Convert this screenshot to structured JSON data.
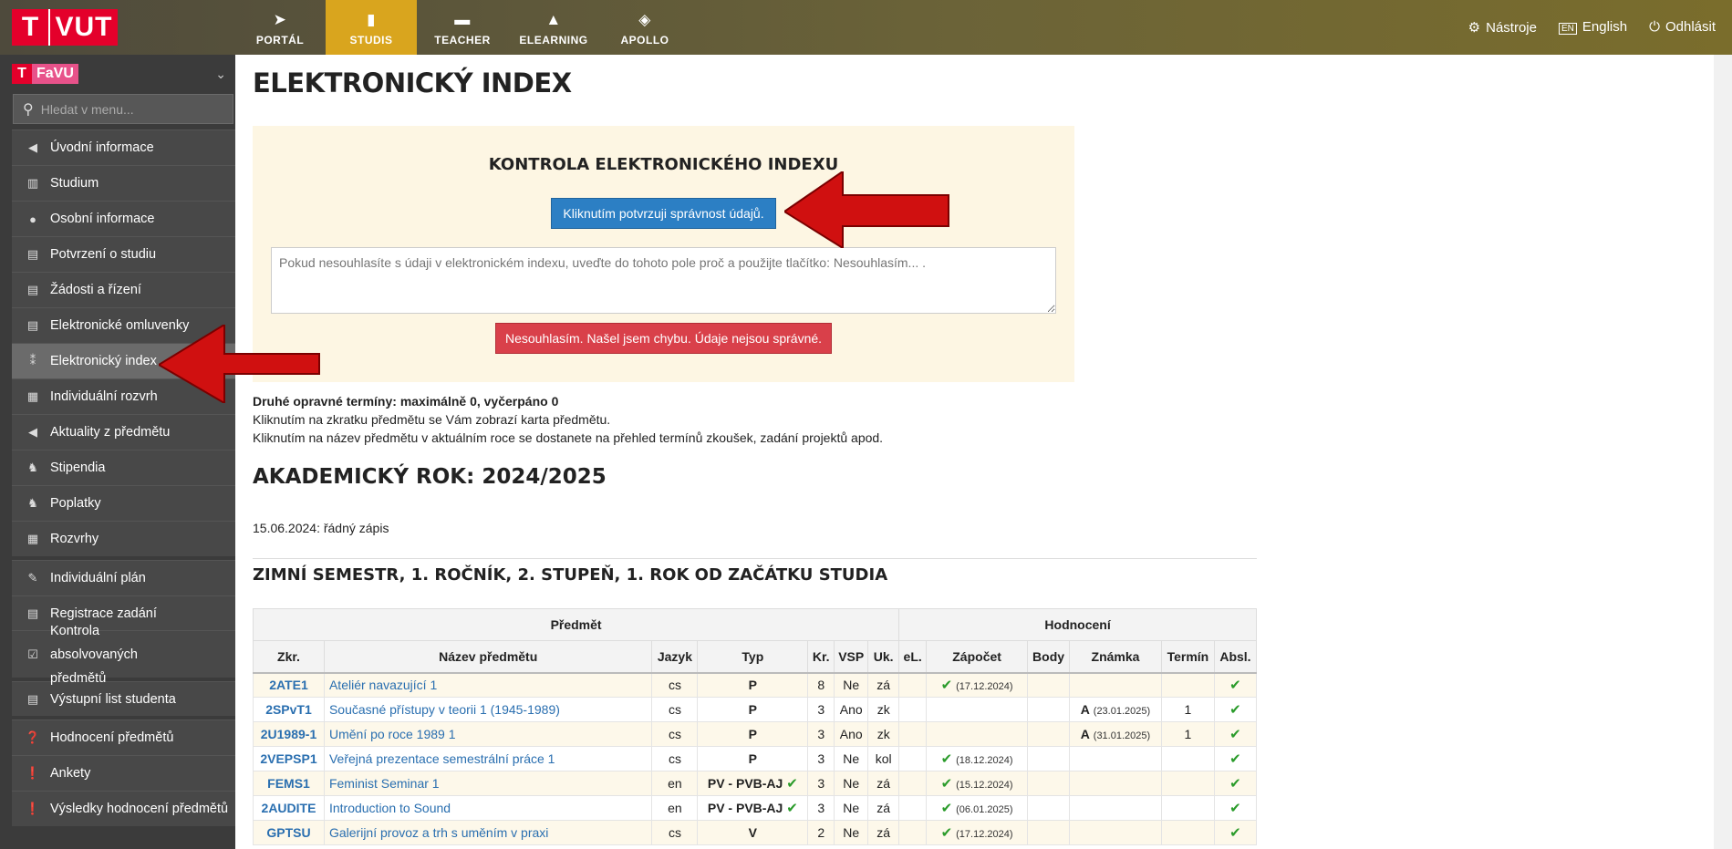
{
  "topbar": {
    "logo_t": "T",
    "logo_text": "VUT",
    "nav": [
      {
        "label": "PORTÁL",
        "icon": "➤"
      },
      {
        "label": "STUDIS",
        "icon": "▮"
      },
      {
        "label": "TEACHER",
        "icon": "▬"
      },
      {
        "label": "ELEARNING",
        "icon": "▲"
      },
      {
        "label": "APOLLO",
        "icon": "◈"
      }
    ],
    "tools": "Nástroje",
    "language": "English",
    "language_icon": "EN",
    "logout": "Odhlásit"
  },
  "sidebar": {
    "faculty_letter": "T",
    "faculty": "FaVU",
    "search_placeholder": "Hledat v menu...",
    "items": [
      {
        "label": "Úvodní informace"
      },
      {
        "label": "Studium"
      },
      {
        "label": "Osobní informace"
      },
      {
        "label": "Potvrzení o studiu"
      },
      {
        "label": "Žádosti a řízení"
      },
      {
        "label": "Elektronické omluvenky"
      },
      {
        "label": "Elektronický index"
      },
      {
        "label": "Individuální rozvrh"
      },
      {
        "label": "Aktuality z předmětu"
      },
      {
        "label": "Stipendia"
      },
      {
        "label": "Poplatky"
      },
      {
        "label": "Rozvrhy"
      },
      {
        "label": "Individuální plán"
      },
      {
        "label": "Registrace zadání"
      },
      {
        "label": "Kontrola absolvovaných předmětů"
      },
      {
        "label": "Výstupní list studenta"
      },
      {
        "label": "Hodnocení předmětů"
      },
      {
        "label": "Ankety"
      },
      {
        "label": "Výsledky hodnocení předmětů"
      }
    ]
  },
  "main": {
    "title": "ELEKTRONICKÝ INDEX",
    "control": {
      "heading": "KONTROLA ELEKTRONICKÉHO INDEXU",
      "confirm_button": "Kliknutím potvrzuji správnost údajů.",
      "textarea_placeholder": "Pokud nesouhlasíte s údaji v elektronickém indexu, uveďte do tohoto pole proč a použijte tlačítko: Nesouhlasím... .",
      "disagree_button": "Nesouhlasím. Našel jsem chybu. Údaje nejsou správné."
    },
    "info_bold": "Druhé opravné termíny: maximálně 0, vyčerpáno 0",
    "info_line1": "Kliknutím na zkratku předmětu se Vám zobrazí karta předmětu.",
    "info_line2": "Kliknutím na název předmětu v aktuálním roce se dostanete na přehled termínů zkoušek, zadání projektů apod.",
    "year_heading": "AKADEMICKÝ ROK: 2024/2025",
    "enrollment": "15.06.2024: řádný zápis",
    "semester_heading": "ZIMNÍ SEMESTR, 1. ROČNÍK, 2. STUPEŇ, 1. ROK OD ZAČÁTKU STUDIA"
  },
  "table": {
    "group_headers": {
      "subject": "Předmět",
      "evaluation": "Hodnocení"
    },
    "columns": [
      "Zkr.",
      "Název předmětu",
      "Jazyk",
      "Typ",
      "Kr.",
      "VSP",
      "Uk.",
      "eL.",
      "Zápočet",
      "Body",
      "Známka",
      "Termín",
      "Absl."
    ],
    "rows": [
      {
        "code": "2ATE1",
        "name": "Ateliér navazující 1",
        "lang": "cs",
        "type": "P",
        "cr": "8",
        "vsp": "Ne",
        "uk": "zá",
        "zap": "(17.12.2024)",
        "grade": "",
        "gdate": "",
        "term": ""
      },
      {
        "code": "2SPvT1",
        "name": "Současné přístupy v teorii 1 (1945-1989)",
        "lang": "cs",
        "type": "P",
        "cr": "3",
        "vsp": "Ano",
        "uk": "zk",
        "zap": "",
        "grade": "A",
        "gdate": "(23.01.2025)",
        "term": "1"
      },
      {
        "code": "2U1989-1",
        "name": "Umění po roce 1989 1",
        "lang": "cs",
        "type": "P",
        "cr": "3",
        "vsp": "Ano",
        "uk": "zk",
        "zap": "",
        "grade": "A",
        "gdate": "(31.01.2025)",
        "term": "1"
      },
      {
        "code": "2VEPSP1",
        "name": "Veřejná prezentace semestrální práce 1",
        "lang": "cs",
        "type": "P",
        "cr": "3",
        "vsp": "Ne",
        "uk": "kol",
        "zap": "(18.12.2024)",
        "grade": "",
        "gdate": "",
        "term": ""
      },
      {
        "code": "FEMS1",
        "name": "Feminist Seminar 1",
        "lang": "en",
        "type": "PV - PVB-AJ",
        "cr": "3",
        "vsp": "Ne",
        "uk": "zá",
        "zap": "(15.12.2024)",
        "grade": "",
        "gdate": "",
        "term": ""
      },
      {
        "code": "2AUDITE",
        "name": "Introduction to Sound",
        "lang": "en",
        "type": "PV - PVB-AJ",
        "cr": "3",
        "vsp": "Ne",
        "uk": "zá",
        "zap": "(06.01.2025)",
        "grade": "",
        "gdate": "",
        "term": ""
      },
      {
        "code": "GPTSU",
        "name": "Galerijní provoz a trh s uměním v praxi",
        "lang": "cs",
        "type": "V",
        "cr": "2",
        "vsp": "Ne",
        "uk": "zá",
        "zap": "(17.12.2024)",
        "grade": "",
        "gdate": "",
        "term": ""
      }
    ]
  },
  "colors": {
    "accent_gold": "#d9a51e",
    "brand_red": "#e4002b",
    "link_blue": "#2a6fb0",
    "check_green": "#2a9b2a"
  }
}
